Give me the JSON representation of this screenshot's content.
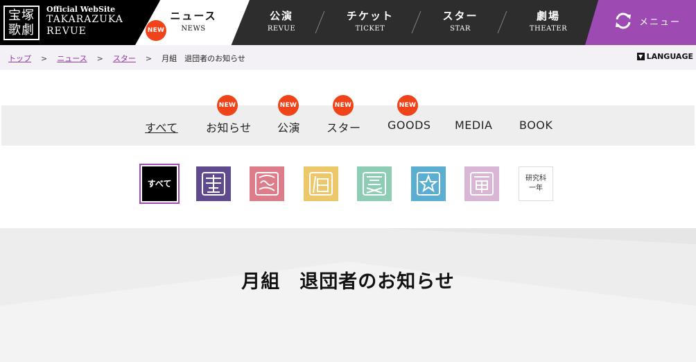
{
  "header": {
    "seal_text_1": "宝塚",
    "seal_text_2": "歌劇",
    "site_sub": "Official WebSite",
    "site_name_1": "TAKARAZUKA",
    "site_name_2": "REVUE",
    "nav": [
      {
        "ja": "ニュース",
        "en": "NEWS"
      },
      {
        "ja": "公演",
        "en": "REVUE"
      },
      {
        "ja": "チケット",
        "en": "TICKET"
      },
      {
        "ja": "スター",
        "en": "STAR"
      },
      {
        "ja": "劇場",
        "en": "THEATER"
      }
    ],
    "new_badge": "NEW",
    "menu_label": "メニュー",
    "accent": "#9d4bb3",
    "badge_color": "#f0431a"
  },
  "breadcrumb": {
    "items": [
      "トップ",
      "ニュース",
      "スター"
    ],
    "separator": ">",
    "current": "月組　退団者のお知らせ"
  },
  "language_label": "LANGUAGE",
  "tabs": [
    {
      "label": "すべて",
      "new": false
    },
    {
      "label": "お知らせ",
      "new": true
    },
    {
      "label": "公演",
      "new": true
    },
    {
      "label": "スター",
      "new": true
    },
    {
      "label": "GOODS",
      "new": true
    },
    {
      "label": "MEDIA",
      "new": false
    },
    {
      "label": "BOOK",
      "new": false
    }
  ],
  "troupes": {
    "all_label": "すべて",
    "icons": [
      {
        "name": "troupe-icon-1",
        "color": "#5e4a8c"
      },
      {
        "name": "troupe-icon-2",
        "color": "#dd7d8a"
      },
      {
        "name": "troupe-icon-3",
        "color": "#ecc86a"
      },
      {
        "name": "troupe-icon-4",
        "color": "#8ccdb4"
      },
      {
        "name": "troupe-icon-5",
        "color": "#5aaed1"
      },
      {
        "name": "troupe-icon-6",
        "color": "#d9b6d6"
      }
    ],
    "study_label_1": "研究科",
    "study_label_2": "一年"
  },
  "page_title": "月組　退団者のお知らせ"
}
